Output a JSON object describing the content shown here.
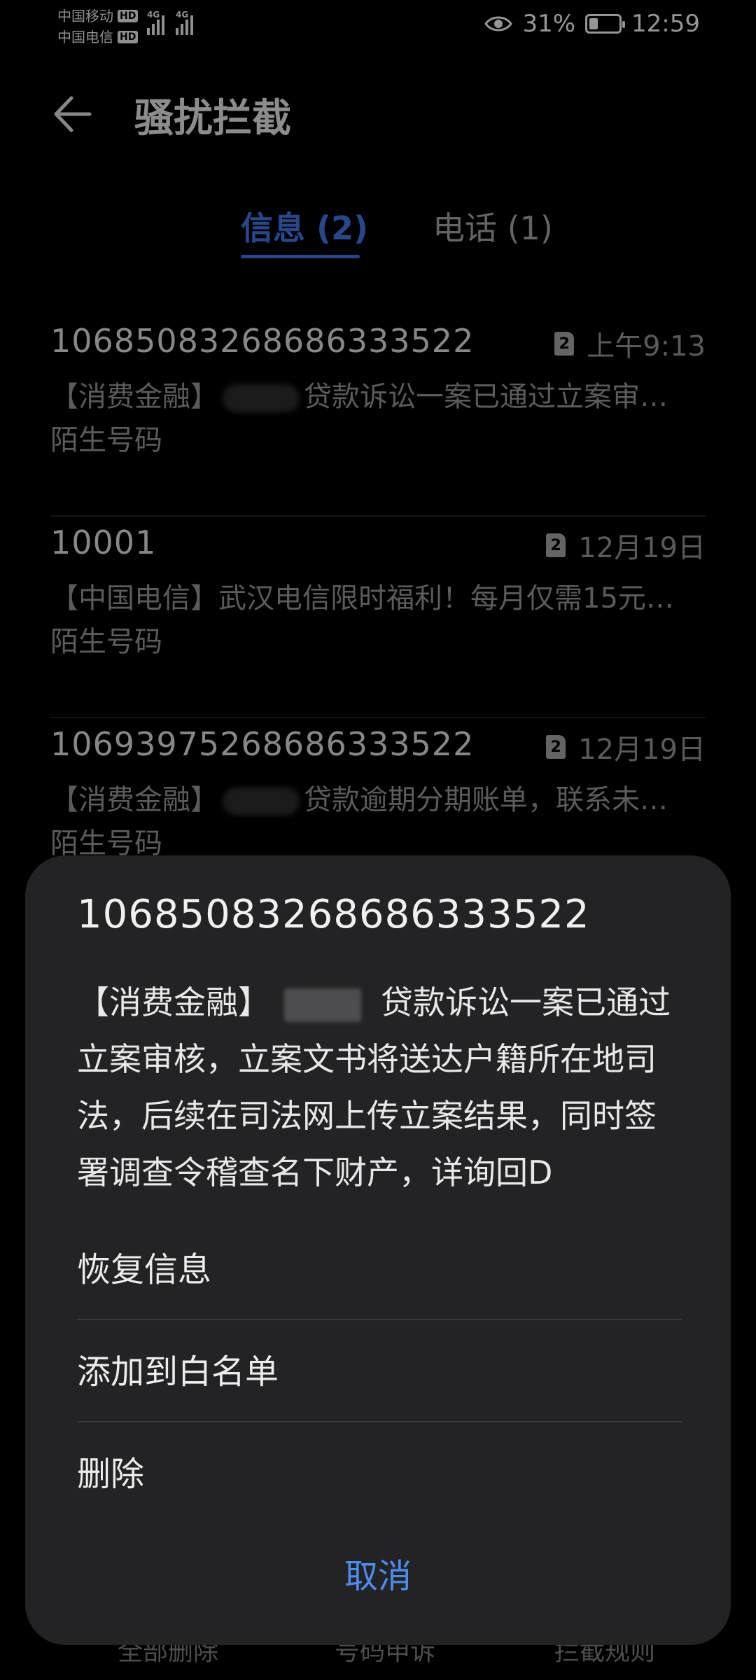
{
  "status_bar": {
    "carrier1": "中国移动",
    "carrier2": "中国电信",
    "hd": "HD",
    "network1": "4G",
    "network2": "4G",
    "battery": "31%",
    "battery_level": 0.31,
    "time": "12:59"
  },
  "app_bar": {
    "title": "骚扰拦截",
    "back_icon": "back-arrow-icon"
  },
  "tabs": [
    {
      "label": "信息 (2)",
      "active": true
    },
    {
      "label": "电话 (1)",
      "active": false
    }
  ],
  "messages": [
    {
      "number": "10685083268686333522",
      "sim": "2",
      "time": "上午9:13",
      "preview_prefix": "【消费金融】",
      "preview_text": "贷款诉讼一案已通过立案审…",
      "tag": "陌生号码"
    },
    {
      "number": "10001",
      "sim": "2",
      "time": "12月19日",
      "preview_prefix": "",
      "preview_text": "【中国电信】武汉电信限时福利！每月仅需15元…",
      "tag": "陌生号码"
    },
    {
      "number": "10693975268686333522",
      "sim": "2",
      "time": "12月19日",
      "preview_prefix": "【消费金融】",
      "preview_text": "贷款逾期分期账单，联系未…",
      "tag": "陌生号码"
    }
  ],
  "bottom_toolbar": {
    "delete_all": "全部删除",
    "number_appeal": "号码申诉",
    "block_rules": "拦截规则"
  },
  "sheet": {
    "number": "10685083268686333522",
    "body_prefix": "【消费金融】",
    "body_text": "贷款诉讼一案已通过立案审核，立案文书将送达户籍所在地司法，后续在司法网上传立案结果，同时签署调查令稽查名下财产，详询回D",
    "actions": [
      "恢复信息",
      "添加到白名单",
      "删除"
    ],
    "cancel": "取消"
  },
  "colors": {
    "accent": "#3b6fd6",
    "cancel": "#4f8cf0",
    "sheet_bg": "#232325",
    "background": "#000000"
  }
}
